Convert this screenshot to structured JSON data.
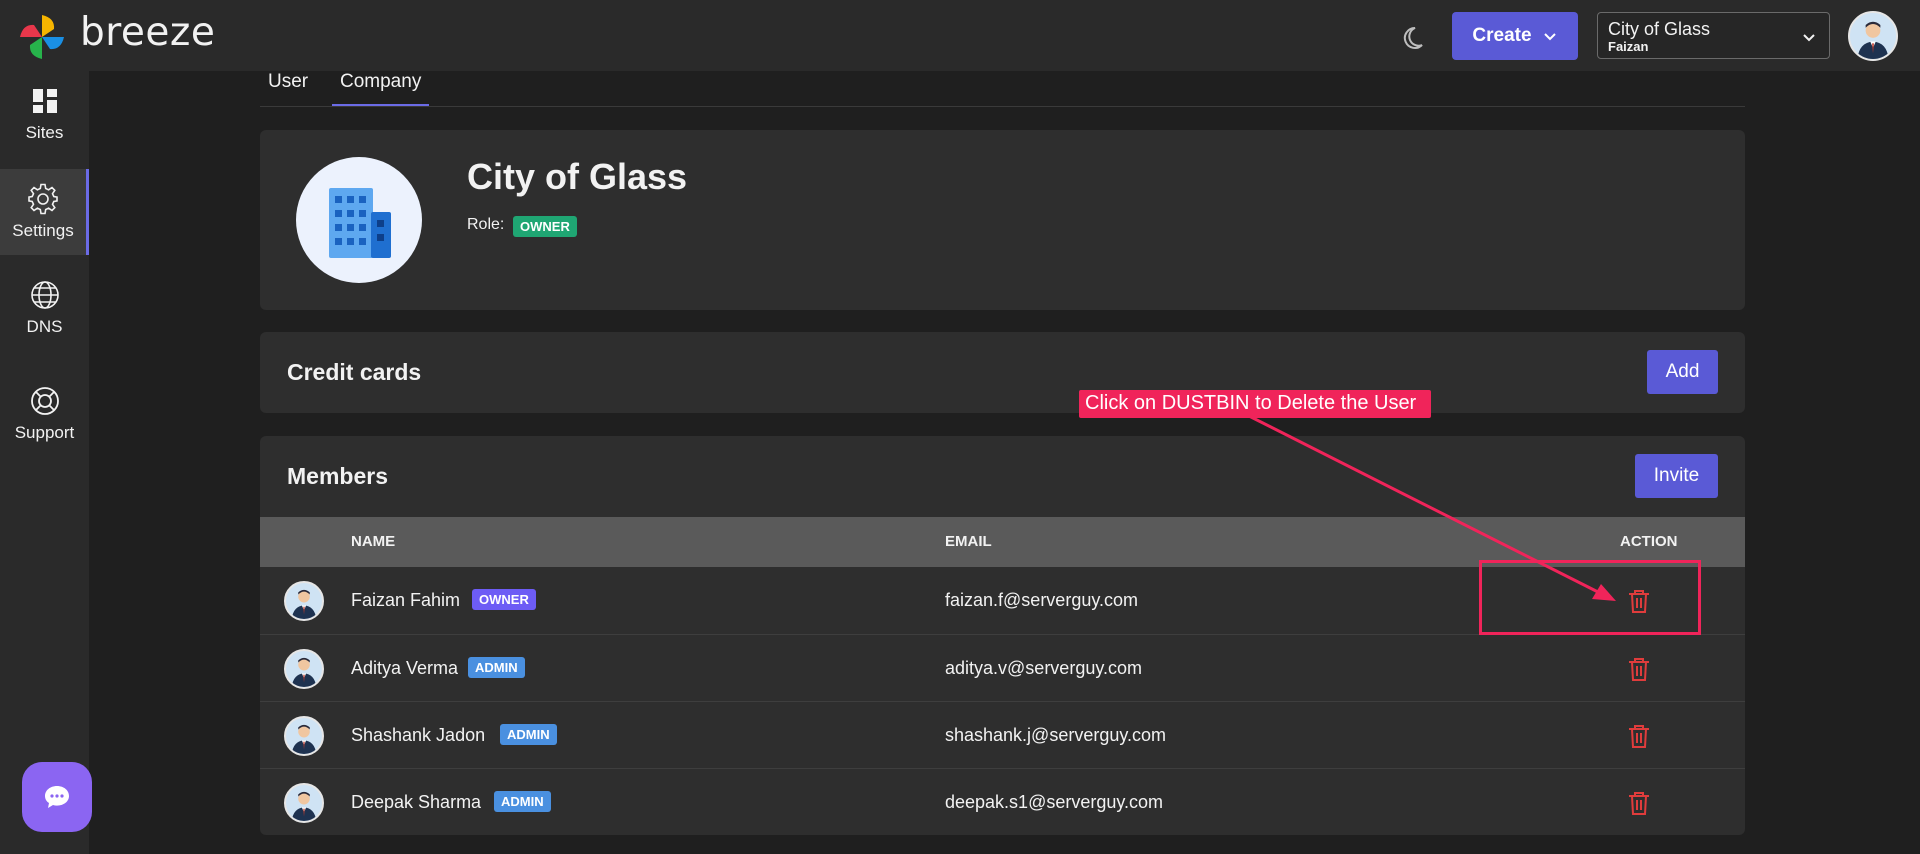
{
  "header": {
    "brand": "breeze",
    "theme_icon": "moon-icon",
    "create_label": "Create",
    "company_select": {
      "name": "City of Glass",
      "user": "Faizan"
    }
  },
  "sidebar": {
    "items": [
      {
        "label": "Sites",
        "icon": "sites-grid-icon"
      },
      {
        "label": "Settings",
        "icon": "gear-icon",
        "active": true
      },
      {
        "label": "DNS",
        "icon": "globe-icon"
      },
      {
        "label": "Support",
        "icon": "lifebuoy-icon"
      }
    ],
    "chat_icon": "chat-bubble-icon"
  },
  "tabs": [
    {
      "label": "User"
    },
    {
      "label": "Company",
      "active": true
    }
  ],
  "company": {
    "name": "City of Glass",
    "role_label": "Role:",
    "role": "OWNER"
  },
  "credit_cards": {
    "title": "Credit cards",
    "add_label": "Add"
  },
  "members": {
    "title": "Members",
    "invite_label": "Invite",
    "columns": {
      "name": "NAME",
      "email": "EMAIL",
      "action": "ACTION"
    },
    "rows": [
      {
        "name": "Faizan Fahim",
        "role": "OWNER",
        "email": "faizan.f@serverguy.com"
      },
      {
        "name": "Aditya Verma",
        "role": "ADMIN",
        "email": "aditya.v@serverguy.com"
      },
      {
        "name": "Shashank Jadon",
        "role": "ADMIN",
        "email": "shashank.j@serverguy.com"
      },
      {
        "name": "Deepak Sharma",
        "role": "ADMIN",
        "email": "deepak.s1@serverguy.com"
      }
    ]
  },
  "annotation": {
    "text": "Click on DUSTBIN to Delete the User"
  },
  "colors": {
    "accent": "#5a5ad6",
    "owner_badge": "#6d5cf5",
    "admin_badge": "#4a90e0",
    "role_badge": "#1fa673",
    "delete": "#e03c3c",
    "annotation": "#f0245a"
  }
}
